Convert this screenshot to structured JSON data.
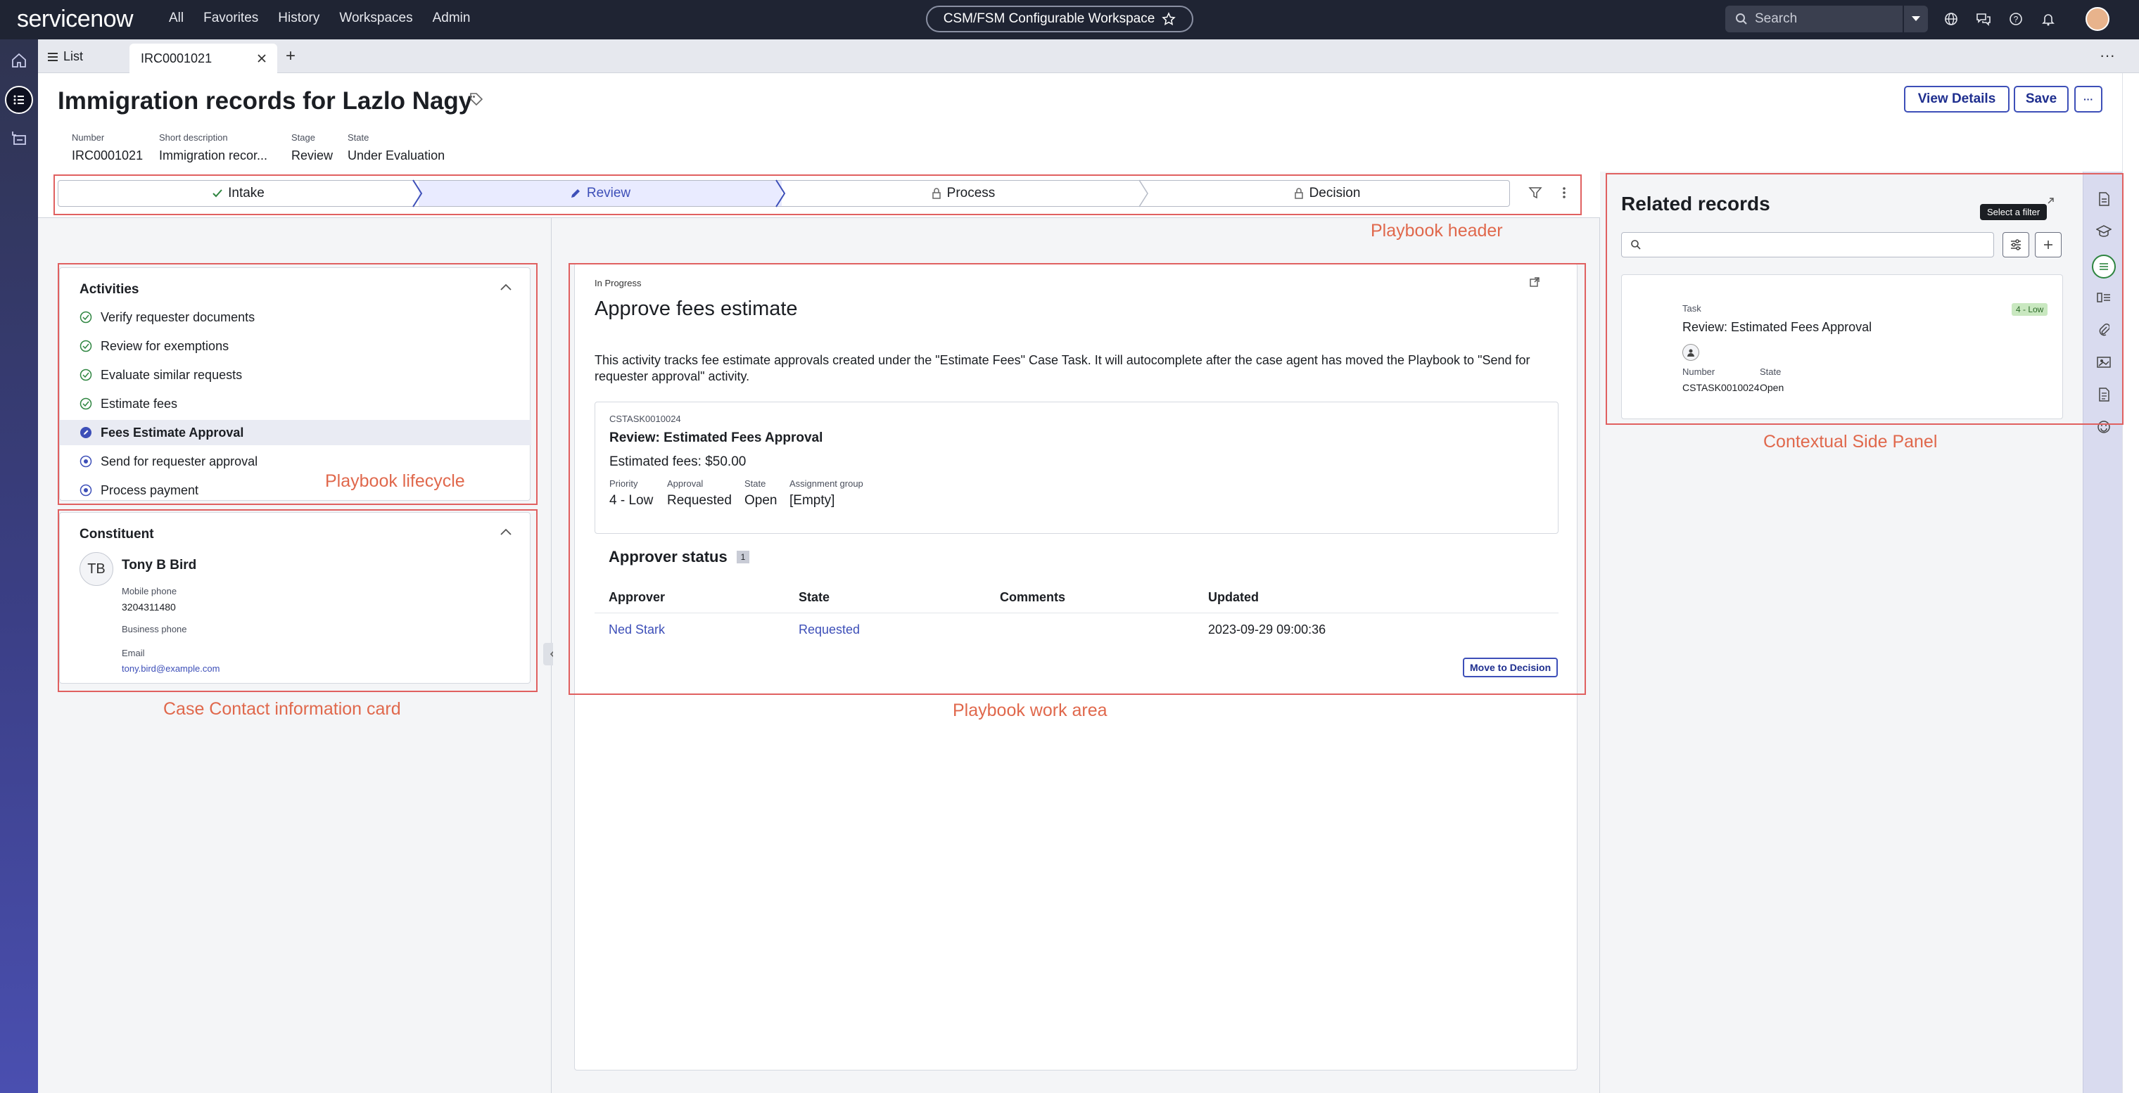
{
  "nav": {
    "logo": "servicenow",
    "links": [
      "All",
      "Favorites",
      "History",
      "Workspaces",
      "Admin"
    ],
    "workspace_name": "CSM/FSM Configurable Workspace",
    "search_placeholder": "Search"
  },
  "tabs": {
    "list_label": "List",
    "active_label": "IRC0001021"
  },
  "header": {
    "title": "Immigration records for Lazlo Nagy",
    "buttons": {
      "view_details": "View Details",
      "save": "Save",
      "more": "···"
    },
    "meta": [
      {
        "key": "Number",
        "value": "IRC0001021"
      },
      {
        "key": "Short description",
        "value": "Immigration recor..."
      },
      {
        "key": "Stage",
        "value": "Review"
      },
      {
        "key": "State",
        "value": "Under Evaluation"
      }
    ]
  },
  "stages": [
    {
      "label": "Intake",
      "status": "done"
    },
    {
      "label": "Review",
      "status": "active"
    },
    {
      "label": "Process",
      "status": "locked"
    },
    {
      "label": "Decision",
      "status": "locked"
    }
  ],
  "activities": {
    "title": "Activities",
    "items": [
      {
        "label": "Verify requester documents",
        "status": "done"
      },
      {
        "label": "Review for exemptions",
        "status": "done"
      },
      {
        "label": "Evaluate similar requests",
        "status": "done"
      },
      {
        "label": "Estimate fees",
        "status": "done"
      },
      {
        "label": "Fees Estimate Approval",
        "status": "current"
      },
      {
        "label": "Send for requester approval",
        "status": "pending"
      },
      {
        "label": "Process payment",
        "status": "pending"
      }
    ]
  },
  "constituent": {
    "title": "Constituent",
    "initials": "TB",
    "name": "Tony B Bird",
    "mobile_label": "Mobile phone",
    "mobile": "3204311480",
    "business_label": "Business phone",
    "email_label": "Email",
    "email": "tony.bird@example.com"
  },
  "work": {
    "status": "In Progress",
    "title": "Approve fees estimate",
    "description": "This activity tracks fee estimate approvals created under the \"Estimate Fees\" Case Task.  It will autocomplete after the case agent has moved the Playbook to \"Send for requester approval\" activity.",
    "task": {
      "number": "CSTASK0010024",
      "title": "Review: Estimated Fees Approval",
      "fees": "Estimated fees: $50.00",
      "fields": [
        {
          "key": "Priority",
          "value": "4 - Low"
        },
        {
          "key": "Approval",
          "value": "Requested"
        },
        {
          "key": "State",
          "value": "Open"
        },
        {
          "key": "Assignment group",
          "value": "[Empty]"
        }
      ]
    },
    "approver_title": "Approver status",
    "approver_count": "1",
    "columns": [
      "Approver",
      "State",
      "Comments",
      "Updated"
    ],
    "rows": [
      {
        "approver": "Ned Stark",
        "state": "Requested",
        "comments": "",
        "updated": "2023-09-29 09:00:36"
      }
    ],
    "move_button": "Move to Decision"
  },
  "related": {
    "title": "Related records",
    "tooltip": "Select a filter",
    "card": {
      "type": "Task",
      "badge": "4 - Low",
      "title": "Review: Estimated Fees Approval",
      "number_label": "Number",
      "number": "CSTASK0010024",
      "state_label": "State",
      "state": "Open"
    }
  },
  "annotations": {
    "playbook_header": "Playbook header",
    "playbook_lifecycle": "Playbook lifecycle",
    "contact_card": "Case Contact information card",
    "work_area": "Playbook work area",
    "side_panel": "Contextual Side Panel"
  },
  "colors": {
    "nav_bg": "#1f2433",
    "accent": "#3d4fb8",
    "annotation": "#e0684c",
    "success": "#2e8540",
    "low_badge": "#c9e8c0"
  }
}
